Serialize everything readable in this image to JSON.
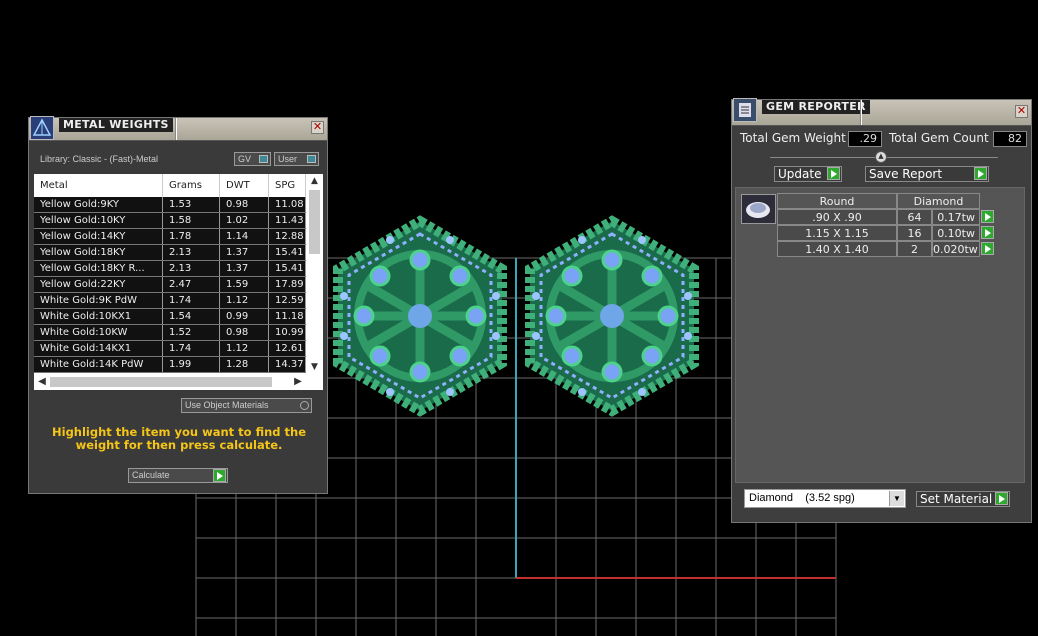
{
  "metal_weights": {
    "title": "METAL WEIGHTS",
    "close": "✕",
    "library": "Library: Classic - (Fast)-Metal",
    "gv_label": "GV",
    "user_label": "User",
    "columns": [
      "Metal",
      "Grams",
      "DWT",
      "SPG"
    ],
    "rows": [
      [
        "Yellow Gold:9KY",
        "1.53",
        "0.98",
        "11.08"
      ],
      [
        "Yellow Gold:10KY",
        "1.58",
        "1.02",
        "11.43"
      ],
      [
        "Yellow Gold:14KY",
        "1.78",
        "1.14",
        "12.88"
      ],
      [
        "Yellow Gold:18KY",
        "2.13",
        "1.37",
        "15.41"
      ],
      [
        "Yellow Gold:18KY R...",
        "2.13",
        "1.37",
        "15.41"
      ],
      [
        "Yellow Gold:22KY",
        "2.47",
        "1.59",
        "17.89"
      ],
      [
        "White Gold:9K PdW",
        "1.74",
        "1.12",
        "12.59"
      ],
      [
        "White Gold:10KX1",
        "1.54",
        "0.99",
        "11.18"
      ],
      [
        "White Gold:10KW",
        "1.52",
        "0.98",
        "10.99"
      ],
      [
        "White Gold:14KX1",
        "1.74",
        "1.12",
        "12.61"
      ],
      [
        "White Gold:14K PdW",
        "1.99",
        "1.28",
        "14.37"
      ]
    ],
    "use_object_materials": "Use Object Materials",
    "hint": "Highlight the item you want to find the weight for then press calculate.",
    "calculate": "Calculate"
  },
  "gem_reporter": {
    "title": "GEM REPORTER",
    "close": "✕",
    "total_weight_label": "Total Gem Weight",
    "total_weight_value": ".29",
    "total_count_label": "Total Gem Count",
    "total_count_value": "82",
    "update": "Update",
    "save_report": "Save Report",
    "header_shape": "Round",
    "header_material": "Diamond",
    "rows": [
      [
        ".90 X .90",
        "64",
        "0.17tw"
      ],
      [
        "1.15 X 1.15",
        "16",
        "0.10tw"
      ],
      [
        "1.40 X 1.40",
        "2",
        "0.020tw"
      ]
    ],
    "material_select": "Diamond    (3.52 spg)",
    "set_material": "Set Material"
  }
}
